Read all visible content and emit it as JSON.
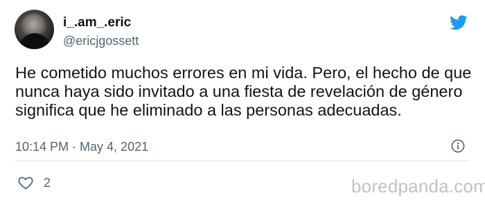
{
  "tweet": {
    "display_name": "i_.am_.eric",
    "handle": "@ericjgossett",
    "text": "He cometido muchos errores en mi vida. Pero, el hecho de que nunca haya sido invitado a una fiesta de revelación de género significa que he eliminado a las personas adecuadas.",
    "timestamp": "10:14 PM · May 4, 2021",
    "like_count": "2"
  },
  "icons": {
    "brand": "twitter-bird-icon",
    "info": "info-icon",
    "like": "heart-icon"
  },
  "colors": {
    "twitter_blue": "#1d9bf0",
    "text_primary": "#0f1419",
    "text_secondary": "#536471",
    "watermark": "#bfc3c6"
  },
  "watermark": {
    "text": "boredpanda.com"
  }
}
